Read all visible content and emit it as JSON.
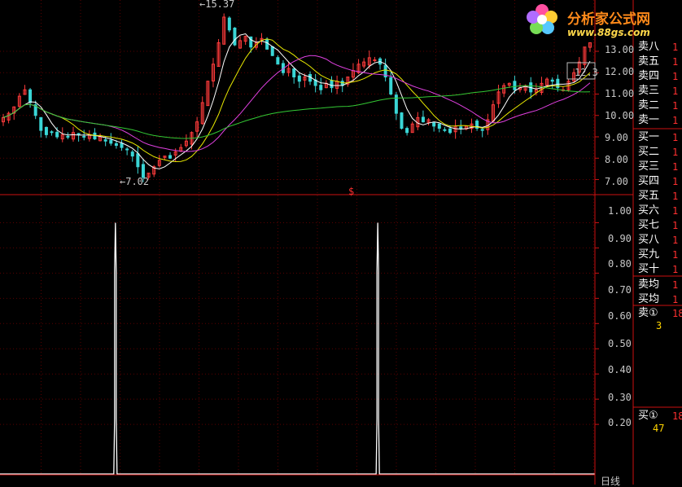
{
  "colors": {
    "background": "#000000",
    "grid": "#5a0000",
    "divider": "#cc1111",
    "candle_up": "#ff3b3b",
    "candle_down": "#3ad6d6",
    "ma_white": "#ffffff",
    "ma_yellow": "#e8e800",
    "ma_magenta": "#e040e0",
    "ma_green": "#34c934",
    "signal": "#ffffff"
  },
  "logo": {
    "brand": "分析家公式网",
    "url": "www.88gs.com",
    "icon": "flower-logo-icon"
  },
  "main_panel": {
    "high_marker": "15.37",
    "low_marker": "7.02",
    "right_marker": "12.3",
    "divider_mark": "$",
    "y_ticks": [
      "13.00",
      "12.00",
      "11.00",
      "10.00",
      "9.00",
      "8.00",
      "7.00"
    ]
  },
  "indicator_panel": {
    "y_ticks": [
      "1.00",
      "0.90",
      "0.80",
      "0.70",
      "0.60",
      "0.50",
      "0.40",
      "0.30",
      "0.20"
    ],
    "period_label": "日线"
  },
  "order_book": {
    "sell_levels": [
      {
        "label": "卖八",
        "value": "1"
      },
      {
        "label": "卖五",
        "value": "1"
      },
      {
        "label": "卖四",
        "value": "1"
      },
      {
        "label": "卖三",
        "value": "1"
      },
      {
        "label": "卖二",
        "value": "1"
      },
      {
        "label": "卖一",
        "value": "1"
      }
    ],
    "buy_levels": [
      {
        "label": "买一",
        "value": "1"
      },
      {
        "label": "买二",
        "value": "1"
      },
      {
        "label": "买三",
        "value": "1"
      },
      {
        "label": "买四",
        "value": "1"
      },
      {
        "label": "买五",
        "value": "1"
      },
      {
        "label": "买六",
        "value": "1"
      },
      {
        "label": "买七",
        "value": "1"
      },
      {
        "label": "买八",
        "value": "1"
      },
      {
        "label": "买九",
        "value": "1"
      },
      {
        "label": "买十",
        "value": "1"
      }
    ],
    "avg_levels": [
      {
        "label": "卖均",
        "value": "1"
      },
      {
        "label": "买均",
        "value": "1"
      }
    ],
    "sell_total": {
      "label": "卖①",
      "value": "18",
      "sub": "3"
    },
    "buy_total": {
      "label": "买①",
      "value": "18",
      "sub": "47"
    }
  },
  "chart_data": [
    {
      "type": "candlestick",
      "ylim": [
        6.6,
        15.4
      ],
      "y_ticks": [
        7,
        8,
        9,
        10,
        11,
        12,
        13
      ],
      "annotations": [
        {
          "text": "15.37",
          "value": 15.37
        },
        {
          "text": "7.02",
          "value": 7.02
        },
        {
          "text": "12.3",
          "value": 12.3
        }
      ],
      "series_close": [
        9.9,
        10.1,
        10.4,
        10.9,
        11.2,
        10.6,
        10.0,
        9.3,
        9.1,
        9.2,
        9.0,
        9.1,
        9.0,
        9.2,
        9.1,
        9.0,
        9.1,
        8.9,
        9.0,
        8.8,
        8.7,
        8.6,
        8.5,
        8.4,
        8.1,
        7.6,
        7.1,
        7.3,
        7.6,
        7.9,
        8.1,
        8.0,
        8.3,
        8.5,
        8.8,
        9.2,
        9.7,
        10.6,
        11.6,
        12.4,
        13.4,
        14.6,
        14.0,
        13.3,
        13.5,
        13.7,
        13.2,
        13.4,
        13.6,
        13.1,
        12.8,
        12.4,
        12.0,
        12.2,
        11.8,
        11.6,
        11.8,
        11.6,
        11.4,
        11.2,
        11.5,
        11.3,
        11.6,
        11.4,
        11.8,
        12.1,
        12.4,
        12.5,
        12.7,
        12.6,
        12.4,
        11.8,
        11.0,
        10.1,
        9.4,
        9.2,
        9.6,
        9.9,
        9.7,
        9.8,
        9.5,
        9.4,
        9.3,
        9.2,
        9.5,
        9.4,
        9.5,
        9.6,
        9.4,
        9.3,
        9.8,
        10.5,
        11.1,
        11.4,
        11.5,
        11.2,
        11.3,
        11.4,
        11.1,
        11.2,
        11.5,
        11.7,
        11.6,
        11.3,
        11.2,
        11.6,
        12.0,
        12.5,
        13.2,
        13.4
      ],
      "series": [
        {
          "name": "",
          "color": "white",
          "period": 5
        },
        {
          "name": "",
          "color": "yellow",
          "period": 10
        },
        {
          "name": "",
          "color": "magenta",
          "period": 20
        },
        {
          "name": "",
          "color": "green",
          "period": 60
        }
      ]
    },
    {
      "type": "line",
      "ylim": [
        0,
        1.05
      ],
      "y_ticks": [
        0.2,
        0.3,
        0.4,
        0.5,
        0.6,
        0.7,
        0.8,
        0.9,
        1.0
      ],
      "spikes": [
        {
          "position": 0.194,
          "value": 1.0
        },
        {
          "position": 0.635,
          "value": 1.0
        }
      ]
    }
  ]
}
